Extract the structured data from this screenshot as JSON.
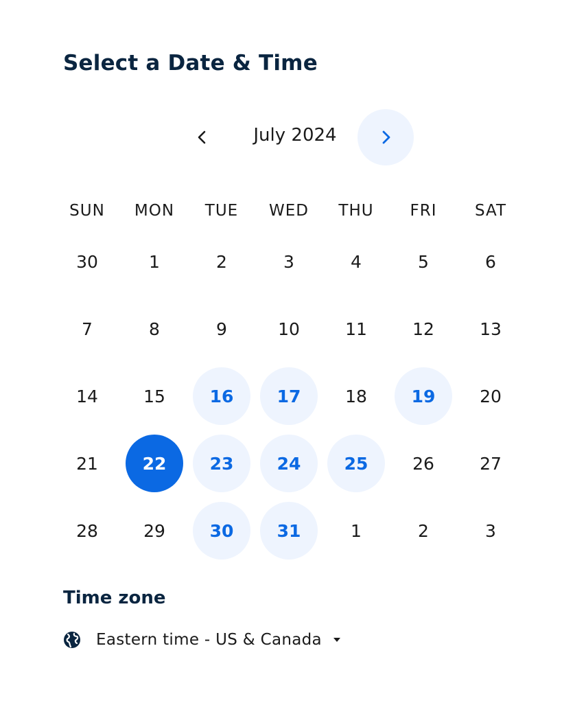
{
  "header": {
    "title": "Select a Date & Time"
  },
  "month_nav": {
    "month_label": "July 2024",
    "prev_icon": "chevron-left-icon",
    "next_icon": "chevron-right-icon"
  },
  "calendar": {
    "weekdays": [
      "SUN",
      "MON",
      "TUE",
      "WED",
      "THU",
      "FRI",
      "SAT"
    ],
    "weeks": [
      [
        {
          "label": "30",
          "state": "outside"
        },
        {
          "label": "1",
          "state": "unavailable"
        },
        {
          "label": "2",
          "state": "unavailable"
        },
        {
          "label": "3",
          "state": "unavailable"
        },
        {
          "label": "4",
          "state": "unavailable"
        },
        {
          "label": "5",
          "state": "unavailable"
        },
        {
          "label": "6",
          "state": "unavailable"
        }
      ],
      [
        {
          "label": "7",
          "state": "unavailable"
        },
        {
          "label": "8",
          "state": "unavailable"
        },
        {
          "label": "9",
          "state": "unavailable"
        },
        {
          "label": "10",
          "state": "unavailable"
        },
        {
          "label": "11",
          "state": "unavailable"
        },
        {
          "label": "12",
          "state": "unavailable"
        },
        {
          "label": "13",
          "state": "unavailable"
        }
      ],
      [
        {
          "label": "14",
          "state": "unavailable"
        },
        {
          "label": "15",
          "state": "unavailable"
        },
        {
          "label": "16",
          "state": "available"
        },
        {
          "label": "17",
          "state": "available"
        },
        {
          "label": "18",
          "state": "unavailable"
        },
        {
          "label": "19",
          "state": "available"
        },
        {
          "label": "20",
          "state": "unavailable"
        }
      ],
      [
        {
          "label": "21",
          "state": "unavailable"
        },
        {
          "label": "22",
          "state": "selected"
        },
        {
          "label": "23",
          "state": "available"
        },
        {
          "label": "24",
          "state": "available"
        },
        {
          "label": "25",
          "state": "available"
        },
        {
          "label": "26",
          "state": "unavailable"
        },
        {
          "label": "27",
          "state": "unavailable"
        }
      ],
      [
        {
          "label": "28",
          "state": "unavailable"
        },
        {
          "label": "29",
          "state": "unavailable"
        },
        {
          "label": "30",
          "state": "available"
        },
        {
          "label": "31",
          "state": "available"
        },
        {
          "label": "1",
          "state": "outside"
        },
        {
          "label": "2",
          "state": "outside"
        },
        {
          "label": "3",
          "state": "outside"
        }
      ]
    ]
  },
  "timezone": {
    "title": "Time zone",
    "value": "Eastern time - US & Canada",
    "icon": "globe-icon",
    "caret_icon": "caret-down-icon"
  },
  "colors": {
    "accent": "#0b69e3",
    "available_bg": "#eef4fe",
    "heading": "#0a2540",
    "text": "#1a1a1a"
  }
}
